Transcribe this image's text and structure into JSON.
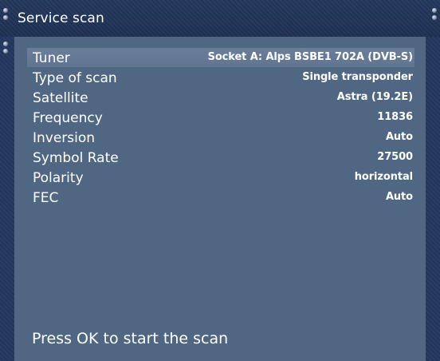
{
  "window": {
    "title": "Service scan"
  },
  "settings": [
    {
      "label": "Tuner",
      "value": "Socket A: Alps BSBE1 702A (DVB-S)",
      "selected": true
    },
    {
      "label": "Type of scan",
      "value": "Single transponder",
      "selected": false
    },
    {
      "label": "Satellite",
      "value": "Astra (19.2E)",
      "selected": false
    },
    {
      "label": "Frequency",
      "value": "11836",
      "selected": false
    },
    {
      "label": "Inversion",
      "value": "Auto",
      "selected": false
    },
    {
      "label": "Symbol Rate",
      "value": "27500",
      "selected": false
    },
    {
      "label": "Polarity",
      "value": "horizontal",
      "selected": false
    },
    {
      "label": "FEC",
      "value": "Auto",
      "selected": false
    }
  ],
  "footer": {
    "hint": "Press OK to start the scan"
  },
  "colors": {
    "title_bar": "#1f3458",
    "panel": "#506784",
    "selection": "#657993",
    "text": "#ffffff"
  }
}
